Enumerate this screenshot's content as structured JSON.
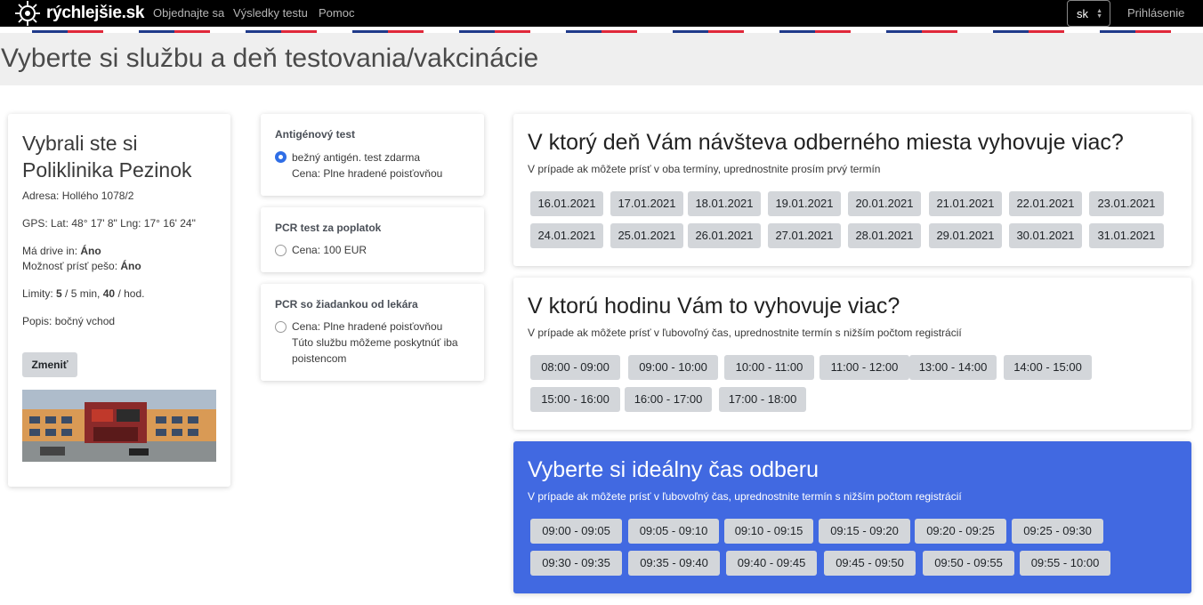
{
  "nav": {
    "brand": "rýchlejšie.sk",
    "links": [
      "Objednajte sa",
      "Výsledky testu",
      "Pomoc"
    ],
    "lang": "sk",
    "login": "Prihlásenie"
  },
  "page_title": "Vyberte si službu a deň testovania/vakcinácie",
  "place": {
    "title": "Vybrali ste si Poliklinika Pezinok",
    "address_label": "Adresa:",
    "address": "Hollého 1078/2",
    "gps_label": "GPS:",
    "gps": "Lat: 48° 17' 8\" Lng: 17° 16' 24\"",
    "drive_label": "Má drive in:",
    "drive": "Áno",
    "walk_label": "Možnosť prísť pešo:",
    "walk": "Áno",
    "limits_label": "Limity:",
    "limit_a": "5",
    "limit_a_unit": "/ 5 min,",
    "limit_b": "40",
    "limit_b_unit": "/ hod.",
    "desc_label": "Popis:",
    "desc": "bočný vchod",
    "change_button": "Zmeniť"
  },
  "services": [
    {
      "title": "Antigénový test",
      "line1": "bežný antigén. test zdarma",
      "line2": "Cena: Plne hradené poisťovňou",
      "selected": true
    },
    {
      "title": "PCR test za poplatok",
      "line1": "Cena: 100 EUR",
      "selected": false
    },
    {
      "title": "PCR so žiadankou od lekára",
      "line1": "Cena: Plne hradené poisťovňou",
      "line2": "Túto službu môžeme poskytnúť iba",
      "line3": "poistencom",
      "selected": false
    }
  ],
  "days": {
    "title": "V ktorý deň Vám návšteva odberného miesta vyhovuje viac?",
    "subtitle": "V prípade ak môžete prísť v oba termíny, uprednostnite prosím prvý termín",
    "items": [
      "16.01.2021",
      "17.01.2021",
      "18.01.2021",
      "19.01.2021",
      "20.01.2021",
      "21.01.2021",
      "22.01.2021",
      "23.01.2021",
      "24.01.2021",
      "25.01.2021",
      "26.01.2021",
      "27.01.2021",
      "28.01.2021",
      "29.01.2021",
      "30.01.2021",
      "31.01.2021"
    ]
  },
  "hours": {
    "title": "V ktorú hodinu Vám to vyhovuje viac?",
    "subtitle": "V prípade ak môžete prísť v ľubovoľný čas, uprednostnite termín s nižším počtom registrácií",
    "items": [
      "08:00 - 09:00",
      "09:00 - 10:00",
      "10:00 - 11:00",
      "11:00 - 12:00",
      "13:00 - 14:00",
      "14:00 - 15:00",
      "15:00 - 16:00",
      "16:00 - 17:00",
      "17:00 - 18:00"
    ]
  },
  "slots": {
    "title": "Vyberte si ideálny čas odberu",
    "subtitle": "V prípade ak môžete prísť v ľubovoľný čas, uprednostnite termín s nižším počtom registrácií",
    "items": [
      "09:00 - 09:05",
      "09:05 - 09:10",
      "09:10 - 09:15",
      "09:15 - 09:20",
      "09:20 - 09:25",
      "09:25 - 09:30",
      "09:30 - 09:35",
      "09:35 - 09:40",
      "09:40 - 09:45",
      "09:45 - 09:50",
      "09:50 - 09:55",
      "09:55 - 10:00"
    ]
  },
  "colors": {
    "navbar": "#000000",
    "accent_blue": "#4169e1",
    "chip_grey": "#d3d6da",
    "radio_selected": "#2f6ee6"
  }
}
